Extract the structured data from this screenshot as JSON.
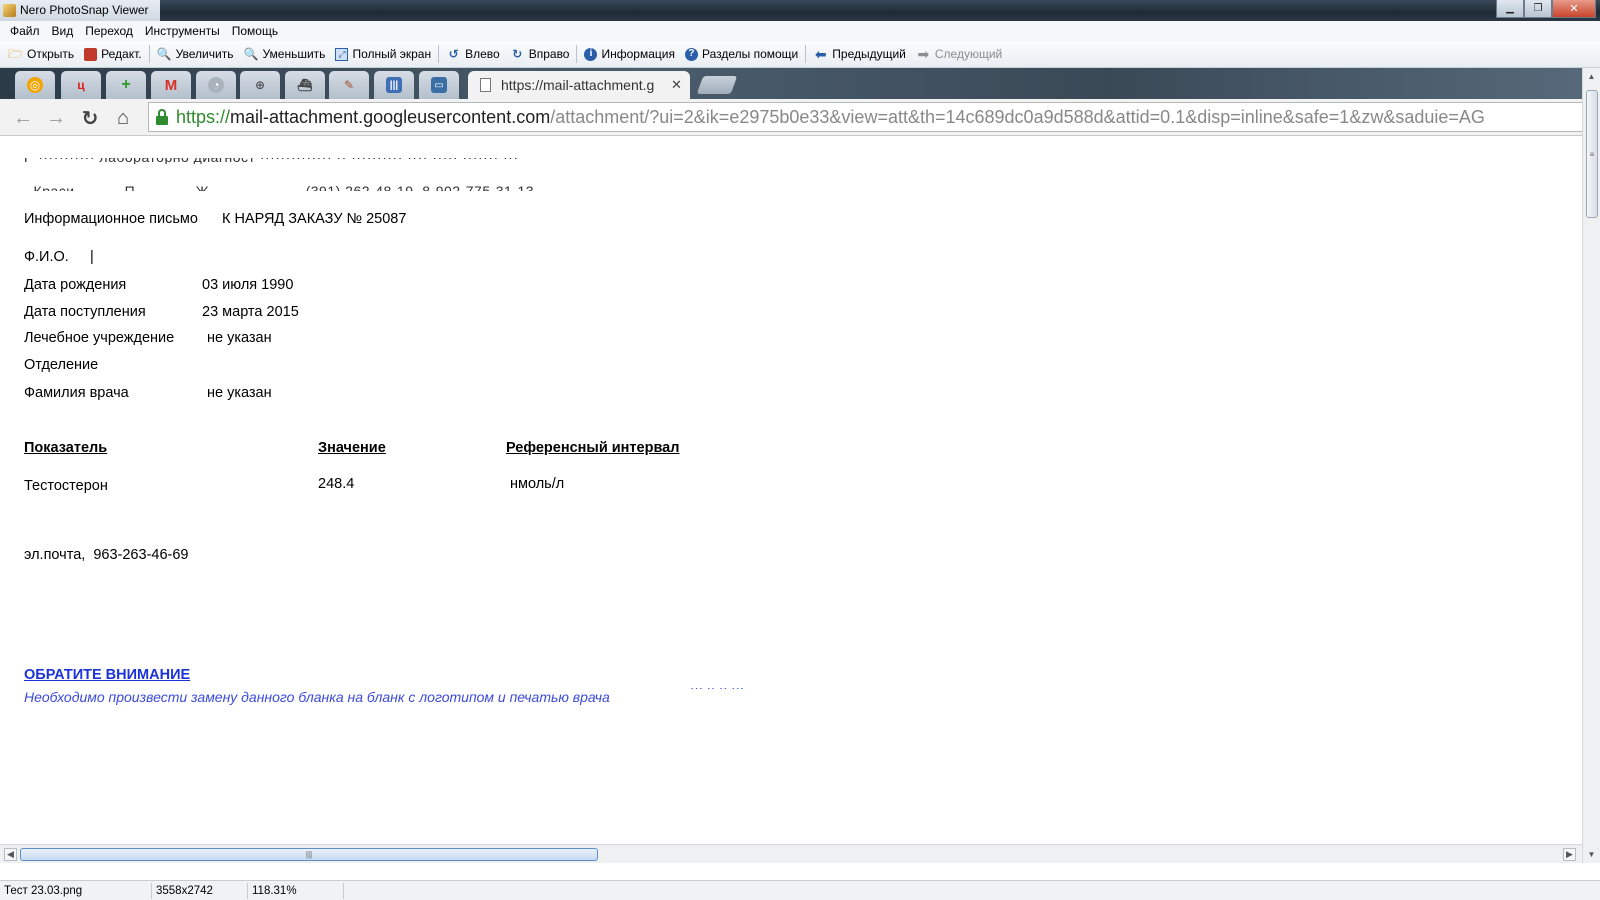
{
  "window": {
    "title": "Nero PhotoSnap Viewer"
  },
  "menu": [
    "Файл",
    "Вид",
    "Переход",
    "Инструменты",
    "Помощь"
  ],
  "toolbar": {
    "open": "Открыть",
    "edit": "Редакт.",
    "zoom_in": "Увеличить",
    "zoom_out": "Уменьшить",
    "fullscreen": "Полный экран",
    "rotate_left": "Влево",
    "rotate_right": "Вправо",
    "info": "Информация",
    "help": "Разделы помощи",
    "previous": "Предыдущий",
    "next": "Следующий"
  },
  "browser": {
    "pinned_tab_icons": [
      "compass-icon",
      "app-icon",
      "plus-app-icon",
      "gmail-icon",
      "gauge-icon",
      "search-globe-icon",
      "ship-icon",
      "pencil-icon",
      "barcode-icon",
      "chat-icon"
    ],
    "active_tab_title": "https://mail-attachment.g",
    "url": {
      "scheme": "https://",
      "host": "mail-attachment.googleusercontent.com",
      "path": "/attachment/?ui=2&ik=e2975b0e33&view=att&th=14c689dc0a9d588d&attid=0.1&disp=inline&safe=1&zw&saduie=AG"
    }
  },
  "document": {
    "heading_label": "Информационное письмо",
    "heading_order": "К НАРЯД ЗАКАЗУ № 25087",
    "fields": [
      {
        "label": "Ф.И.О.",
        "value": "|"
      },
      {
        "label": "Дата рождения",
        "value": "03 июля 1990"
      },
      {
        "label": "Дата поступления",
        "value": "23 марта 2015"
      },
      {
        "label": "Лечебное учреждение",
        "value": "не указан"
      },
      {
        "label": "Отделение",
        "value": ""
      },
      {
        "label": "Фамилия врача",
        "value": "не указан"
      }
    ],
    "table": {
      "headers": [
        "Показатель",
        "Значение",
        "Референсный интервал"
      ],
      "rows": [
        {
          "name": "Тестостерон",
          "value": "248.4",
          "ref": "нмоль/л"
        }
      ]
    },
    "contact": "эл.почта,  963-263-46-69",
    "notice_title": "ОБРАТИТЕ ВНИМАНИЕ",
    "notice_text": "Необходимо произвести замену данного бланка на бланк с логотипом и печатью врача"
  },
  "status": {
    "filename": "Тест 23.03.png",
    "dimensions": "3558x2742",
    "zoom": "118.31%"
  }
}
